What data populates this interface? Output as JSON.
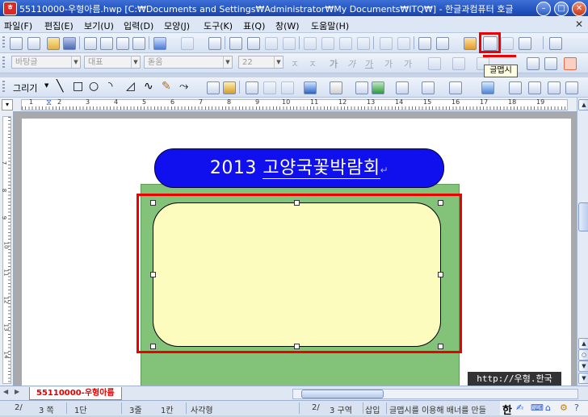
{
  "window": {
    "title": "55110000-우형아름.hwp [C:₩Documents and Settings₩Administrator₩My Documents₩ITQ₩] - 한글과컴퓨터 호글",
    "app_icon": "hwp-app-icon"
  },
  "menu": [
    "파일(F)",
    "편집(E)",
    "보기(U)",
    "입력(D)",
    "모양(J)",
    "도구(K)",
    "표(Q)",
    "창(W)",
    "도움말(H)"
  ],
  "format_bar": {
    "style": "바탕글",
    "font_group": "대표",
    "font": "돋움",
    "size": "22"
  },
  "draw_bar": {
    "draw_label": "그리기"
  },
  "ruler": {
    "ticks": [
      "1",
      "2",
      "3",
      "4",
      "5",
      "6",
      "7",
      "8",
      "9",
      "10",
      "11",
      "12",
      "13",
      "14",
      "15",
      "16",
      "17",
      "18",
      "19"
    ],
    "vticks": [
      "7",
      "8",
      "9",
      "10",
      "11",
      "12",
      "13",
      "14"
    ]
  },
  "document": {
    "banner_year": "2013",
    "banner_text": "고양국꽃박람회",
    "paragraph_mark": "↵"
  },
  "watermark": "http://우형.한국",
  "tooltip": "글맵시",
  "tab": {
    "name": "55110000-우형아름"
  },
  "status": {
    "page": "2/",
    "section_page": "3 쪽",
    "column": "1단",
    "line": "3줄",
    "char": "1칸",
    "object": "사각형",
    "section": "2/",
    "section_label": "3 구역",
    "mode": "삽입",
    "message": "글맵시를 이용해 배너를 만들"
  },
  "tray": {
    "ime": "한"
  }
}
